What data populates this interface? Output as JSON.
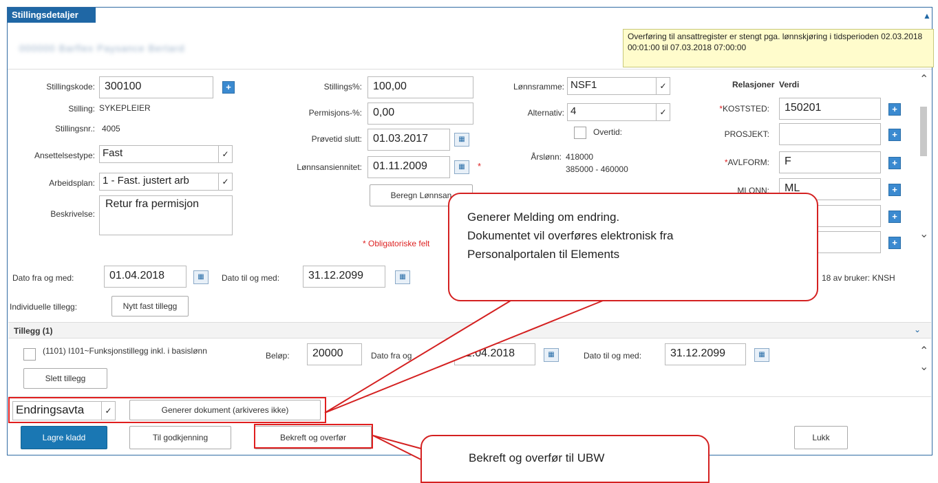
{
  "header": {
    "title": "Stillingsdetaljer",
    "employee_name": "000000 Barflex Paysance Bertard",
    "warning": "Overføring til ansattregister er stengt pga. lønnskjøring i tidsperioden 02.03.2018 00:01:00 til 07.03.2018 07:00:00"
  },
  "form": {
    "stillingskode_label": "Stillingskode:",
    "stillingskode_value": "300100",
    "stilling_label": "Stilling:",
    "stilling_value": "SYKEPLEIER",
    "stillingsnr_label": "Stillingsnr.:",
    "stillingsnr_value": "4005",
    "ansettelsestype_label": "Ansettelsestype:",
    "ansettelsestype_value": "Fast",
    "arbeidsplan_label": "Arbeidsplan:",
    "arbeidsplan_value": "1 - Fast. justert arb",
    "beskrivelse_label": "Beskrivelse:",
    "beskrivelse_value": "Retur fra permisjon",
    "stillingspct_label": "Stillings%:",
    "stillingspct_value": "100,00",
    "permisjonspct_label": "Permisjons-%:",
    "permisjonspct_value": "0,00",
    "provetid_label": "Prøvetid slutt:",
    "provetid_value": "01.03.2017",
    "lonnsansiennitet_label": "Lønnsansiennitet:",
    "lonnsansiennitet_value": "01.11.2009",
    "beregn_button": "Beregn Lønnsan",
    "obligatoriske_note": "* Obligatoriske felt",
    "lonnsramme_label": "Lønnsramme:",
    "lonnsramme_value": "NSF1",
    "alternativ_label": "Alternativ:",
    "alternativ_value": "4",
    "overtid_label": "Overtid:",
    "arslonn_label": "Årslønn:",
    "arslonn_value": "418000",
    "arslonn_range": "385000 - 460000",
    "dato_fra_label": "Dato fra og med:",
    "dato_fra_value": "01.04.2018",
    "dato_til_label": "Dato til og med:",
    "dato_til_value": "31.12.2099",
    "modified_by": "18 av bruker: KNSH",
    "individuelle_label": "Individuelle tillegg:",
    "nytt_fast_button": "Nytt fast tillegg"
  },
  "relations": {
    "header_rel": "Relasjoner",
    "header_val": "Verdi",
    "rows": [
      {
        "label": "KOSTSTED:",
        "required": true,
        "value": "150201"
      },
      {
        "label": "PROSJEKT:",
        "required": false,
        "value": ""
      },
      {
        "label": "AVLFORM:",
        "required": true,
        "value": "F"
      },
      {
        "label": "MLONN:",
        "required": false,
        "value": "ML"
      }
    ]
  },
  "tillegg": {
    "section_title": "Tillegg (1)",
    "item_label": "(1101) I101~Funksjonstillegg inkl. i basislønn",
    "belop_label": "Beløp:",
    "belop_value": "20000",
    "dato_fra_label": "Dato fra og",
    "dato_fra_value": "01.04.2018",
    "dato_til_label": "Dato til og med:",
    "dato_til_value": "31.12.2099",
    "slett_button": "Slett tillegg"
  },
  "actions": {
    "document_select": "Endringsavta",
    "generer_button": "Generer dokument (arkiveres ikke)",
    "lagre_button": "Lagre kladd",
    "godkjenning_button": "Til godkjenning",
    "bekreft_button": "Bekreft og overfør",
    "lukk_button": "Lukk"
  },
  "callouts": {
    "callout1_line1": "Generer Melding om endring.",
    "callout1_line2": "Dokumentet vil overføres elektronisk fra",
    "callout1_line3": "Personalportalen til Elements",
    "callout2": "Bekreft og overfør til UBW"
  },
  "colors": {
    "accent": "#1f67a5",
    "primary_button": "#1a77b3",
    "warning_bg": "#fffccc",
    "annotation_red": "#e01e1e"
  }
}
